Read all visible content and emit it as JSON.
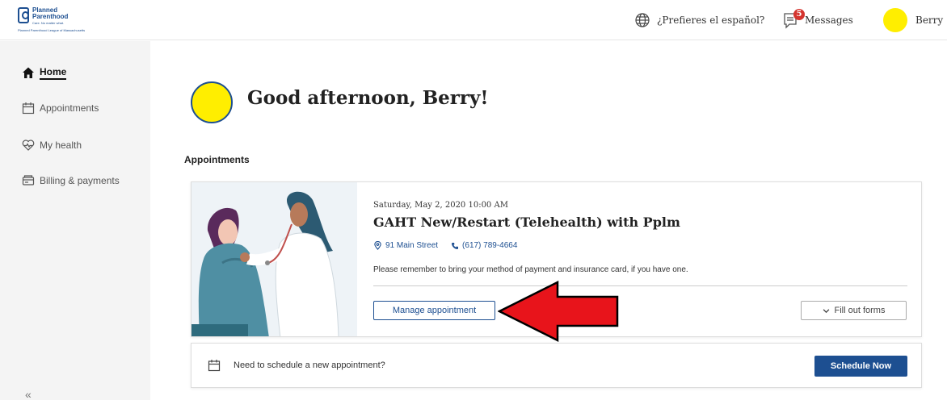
{
  "logo": {
    "line1": "Planned",
    "line2": "Parenthood",
    "tagline": "Care. No matter what.",
    "affiliate": "Planned Parenthood League of Massachusetts"
  },
  "header": {
    "language_link": "¿Prefieres el español?",
    "messages_label": "Messages",
    "messages_count": "5",
    "user_name": "Berry"
  },
  "sidebar": {
    "items": [
      {
        "label": "Home",
        "icon": "home-icon",
        "active": true
      },
      {
        "label": "Appointments",
        "icon": "calendar-icon"
      },
      {
        "label": "My health",
        "icon": "heart-icon"
      },
      {
        "label": "Billing & payments",
        "icon": "billing-icon"
      }
    ],
    "collapse_label": "«"
  },
  "main": {
    "greeting": "Good afternoon, Berry!",
    "section_title": "Appointments",
    "appointment": {
      "datetime": "Saturday, May 2, 2020 10:00 AM",
      "title": "GAHT New/Restart (Telehealth) with Pplm",
      "address": "91 Main Street",
      "phone": "(617) 789-4664",
      "note": "Please remember to bring your method of payment and insurance card, if you have one.",
      "manage_label": "Manage appointment",
      "forms_label": "Fill out forms"
    },
    "schedule": {
      "prompt": "Need to schedule a new appointment?",
      "button_label": "Schedule Now"
    }
  },
  "colors": {
    "brand_blue": "#1d4f91",
    "avatar_yellow": "#ffee00",
    "badge_red": "#d4342e",
    "annotation_arrow": "#e8141b"
  }
}
